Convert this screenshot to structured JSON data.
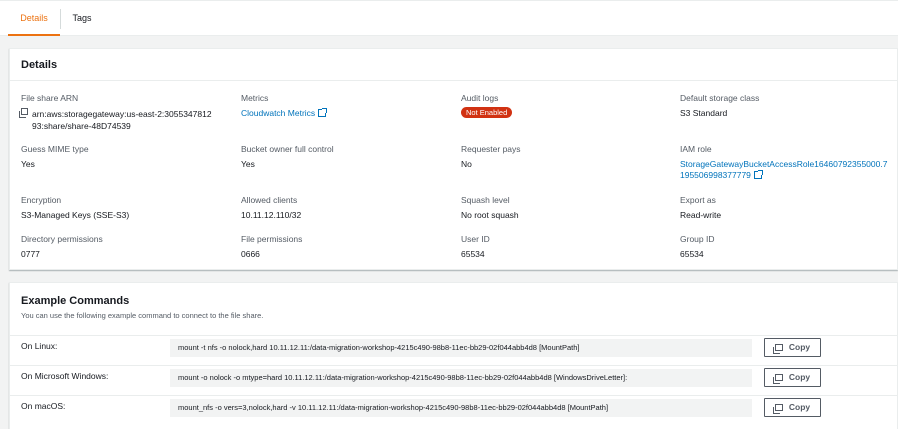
{
  "tabs": [
    {
      "label": "Details",
      "active": true
    },
    {
      "label": "Tags",
      "active": false
    }
  ],
  "details": {
    "title": "Details",
    "fields": {
      "file_share_arn": {
        "label": "File share ARN",
        "value": "arn:aws:storagegateway:us-east-2:305534781293:share/share-48D74539"
      },
      "metrics": {
        "label": "Metrics",
        "value": "Cloudwatch Metrics"
      },
      "audit_logs": {
        "label": "Audit logs",
        "value": "Not Enabled"
      },
      "default_storage_class": {
        "label": "Default storage class",
        "value": "S3 Standard"
      },
      "guess_mime_type": {
        "label": "Guess MIME type",
        "value": "Yes"
      },
      "bucket_owner_full_control": {
        "label": "Bucket owner full control",
        "value": "Yes"
      },
      "requester_pays": {
        "label": "Requester pays",
        "value": "No"
      },
      "iam_role": {
        "label": "IAM role",
        "value": "StorageGatewayBucketAccessRole16460792355000.7195506998377779"
      },
      "encryption": {
        "label": "Encryption",
        "value": "S3-Managed Keys (SSE-S3)"
      },
      "allowed_clients": {
        "label": "Allowed clients",
        "value": "10.11.12.110/32"
      },
      "squash_level": {
        "label": "Squash level",
        "value": "No root squash"
      },
      "export_as": {
        "label": "Export as",
        "value": "Read-write"
      },
      "directory_permissions": {
        "label": "Directory permissions",
        "value": "0777"
      },
      "file_permissions": {
        "label": "File permissions",
        "value": "0666"
      },
      "user_id": {
        "label": "User ID",
        "value": "65534"
      },
      "group_id": {
        "label": "Group ID",
        "value": "65534"
      }
    }
  },
  "commands": {
    "title": "Example Commands",
    "subtitle": "You can use the following example command to connect to the file share.",
    "copy_label": "Copy",
    "rows": [
      {
        "label": "On Linux:",
        "command": "mount -t nfs -o nolock,hard 10.11.12.11:/data-migration-workshop-4215c490-98b8-11ec-bb29-02f044abb4d8 [MountPath]"
      },
      {
        "label": "On Microsoft Windows:",
        "command": "mount -o nolock -o mtype=hard 10.11.12.11:/data-migration-workshop-4215c490-98b8-11ec-bb29-02f044abb4d8 [WindowsDriveLetter]:"
      },
      {
        "label": "On macOS:",
        "command": "mount_nfs -o vers=3,nolock,hard -v 10.11.12.11:/data-migration-workshop-4215c490-98b8-11ec-bb29-02f044abb4d8 [MountPath]"
      }
    ]
  },
  "colors": {
    "accent": "#ec7211",
    "link": "#0073bb",
    "badge_error": "#d13212"
  }
}
